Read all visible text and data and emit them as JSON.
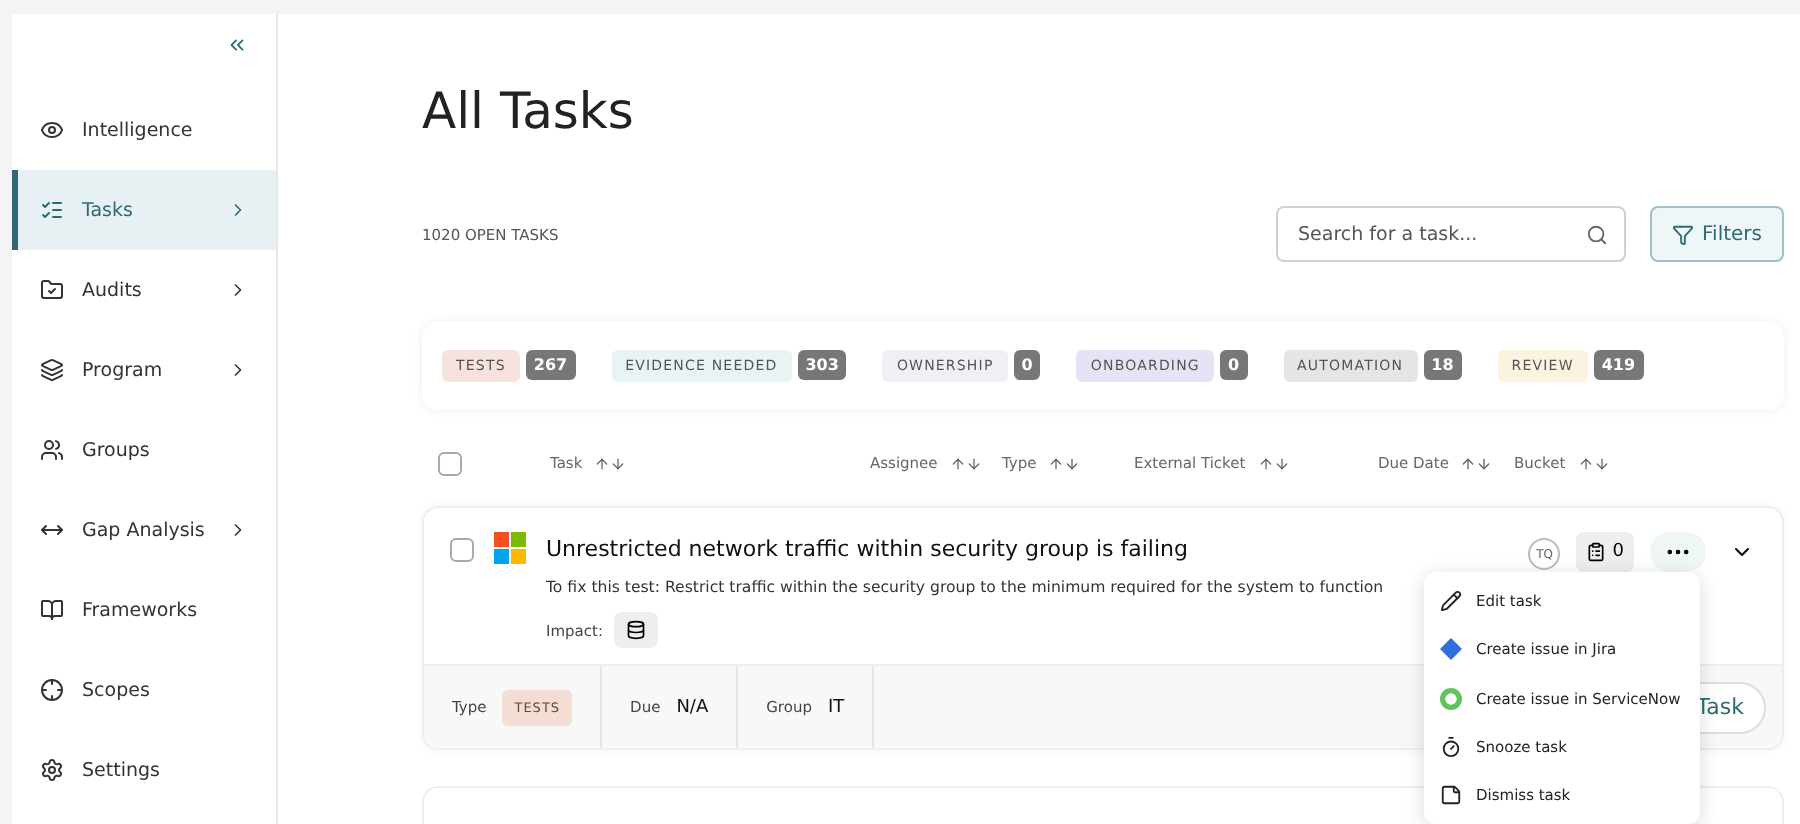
{
  "sidebar": {
    "items": [
      {
        "label": "Intelligence",
        "selected": false,
        "has_submenu": false
      },
      {
        "label": "Tasks",
        "selected": true,
        "has_submenu": true
      },
      {
        "label": "Audits",
        "selected": false,
        "has_submenu": true
      },
      {
        "label": "Program",
        "selected": false,
        "has_submenu": true
      },
      {
        "label": "Groups",
        "selected": false,
        "has_submenu": false
      },
      {
        "label": "Gap Analysis",
        "selected": false,
        "has_submenu": true
      },
      {
        "label": "Frameworks",
        "selected": false,
        "has_submenu": false
      },
      {
        "label": "Scopes",
        "selected": false,
        "has_submenu": false
      },
      {
        "label": "Settings",
        "selected": false,
        "has_submenu": false
      }
    ]
  },
  "page": {
    "title": "All Tasks",
    "count": "1020 OPEN TASKS",
    "search": {
      "placeholder": "Search for a task..."
    },
    "filters_button": "Filters"
  },
  "categories": [
    {
      "label": "TESTS",
      "count": "267",
      "color": "#f6e3dd"
    },
    {
      "label": "EVIDENCE NEEDED",
      "count": "303",
      "color": "#e8f3f4"
    },
    {
      "label": "OWNERSHIP",
      "count": "0",
      "color": "#eef0f3"
    },
    {
      "label": "ONBOARDING",
      "count": "0",
      "color": "#e8e2f6"
    },
    {
      "label": "AUTOMATION",
      "count": "18",
      "color": "#e4e5e7"
    },
    {
      "label": "REVIEW",
      "count": "419",
      "color": "#fbf3df"
    }
  ],
  "table": {
    "all_selected": false,
    "columns": [
      "Task",
      "Assignee",
      "Type",
      "External Ticket",
      "Due Date",
      "Bucket"
    ],
    "rows": [
      {
        "checked": false,
        "title": "Unrestricted network traffic within security group is failing",
        "description": "To fix this test: Restrict traffic within the security group to the minimum required for the system to function",
        "impact_label": "Impact:",
        "assignee": "TQ",
        "evidence_count": "0",
        "expanded": true,
        "details": {
          "type_label": "Type",
          "type": "TESTS",
          "due_label": "Due",
          "due": "N/A",
          "group_label": "Group",
          "group": "IT",
          "action": "Task"
        }
      }
    ]
  },
  "menu": [
    {
      "label": "Edit task"
    },
    {
      "label": "Create issue in Jira"
    },
    {
      "label": "Create issue in ServiceNow"
    },
    {
      "label": "Snooze task"
    },
    {
      "label": "Dismiss task"
    }
  ]
}
